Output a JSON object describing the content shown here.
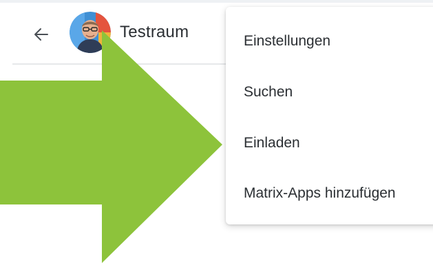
{
  "header": {
    "room_title": "Testraum",
    "back_icon": "arrow-left-icon",
    "avatar_icon": "user-avatar-icon"
  },
  "menu": {
    "items": [
      {
        "label": "Einstellungen"
      },
      {
        "label": "Suchen"
      },
      {
        "label": "Einladen"
      },
      {
        "label": "Matrix-Apps hinzufügen"
      }
    ]
  },
  "overlay": {
    "arrow_icon": "pointer-arrow-icon",
    "arrow_color": "#8dc33b"
  }
}
